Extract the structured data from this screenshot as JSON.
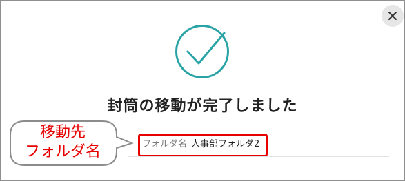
{
  "dialog": {
    "title": "封筒の移動が完了しました",
    "close_icon": "close-icon",
    "status_icon": "check-circle-icon",
    "accent_color": "#2aa3a6"
  },
  "folder": {
    "label": "フォルダ名",
    "value": "人事部フォルダ2"
  },
  "annotation": {
    "line1": "移動先",
    "line2": "フォルダ名",
    "color": "#e60000"
  }
}
